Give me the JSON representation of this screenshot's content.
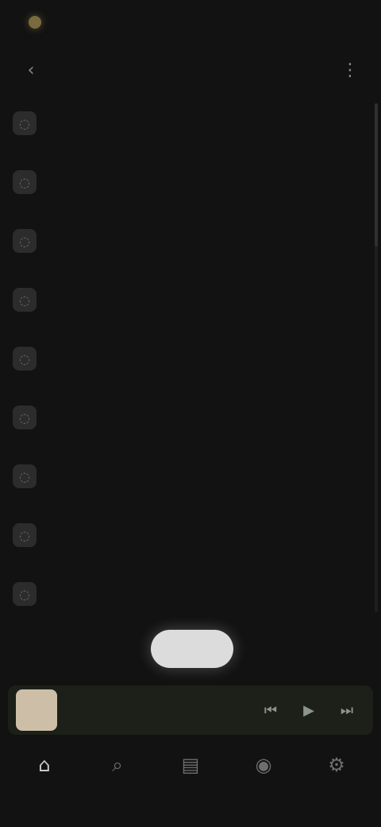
{
  "status": {
    "left_text": "",
    "right_text": ""
  },
  "header": {
    "title": "",
    "back_icon": "back-icon",
    "more_icon": "more-icon"
  },
  "list": {
    "items": [
      {
        "title": "",
        "subtitle": "",
        "icon": "settings-icon"
      },
      {
        "title": "",
        "subtitle": "",
        "icon": "settings-icon"
      },
      {
        "title": "",
        "subtitle": "",
        "icon": "settings-icon"
      },
      {
        "title": "",
        "subtitle": "",
        "icon": "settings-icon"
      },
      {
        "title": "",
        "subtitle": "",
        "icon": "settings-icon"
      },
      {
        "title": "",
        "subtitle": "",
        "icon": "settings-icon"
      },
      {
        "title": "",
        "subtitle": "",
        "icon": "settings-icon"
      },
      {
        "title": "",
        "subtitle": "",
        "icon": "settings-icon"
      },
      {
        "title": "",
        "subtitle": "",
        "icon": "settings-icon"
      }
    ]
  },
  "toast": {
    "label": ""
  },
  "player": {
    "title": "",
    "controls": [
      "previous-icon",
      "play-icon",
      "next-icon"
    ]
  },
  "nav": {
    "items": [
      {
        "label": "",
        "icon": "home-icon",
        "active": true
      },
      {
        "label": "",
        "icon": "search-icon",
        "active": false
      },
      {
        "label": "",
        "icon": "library-icon",
        "active": false
      },
      {
        "label": "",
        "icon": "profile-icon",
        "active": false
      },
      {
        "label": "",
        "icon": "settings-icon",
        "active": false
      }
    ]
  },
  "colors": {
    "background": "#121212",
    "accent": "#cdbfa7",
    "toast_bg": "#dcdcdc"
  }
}
